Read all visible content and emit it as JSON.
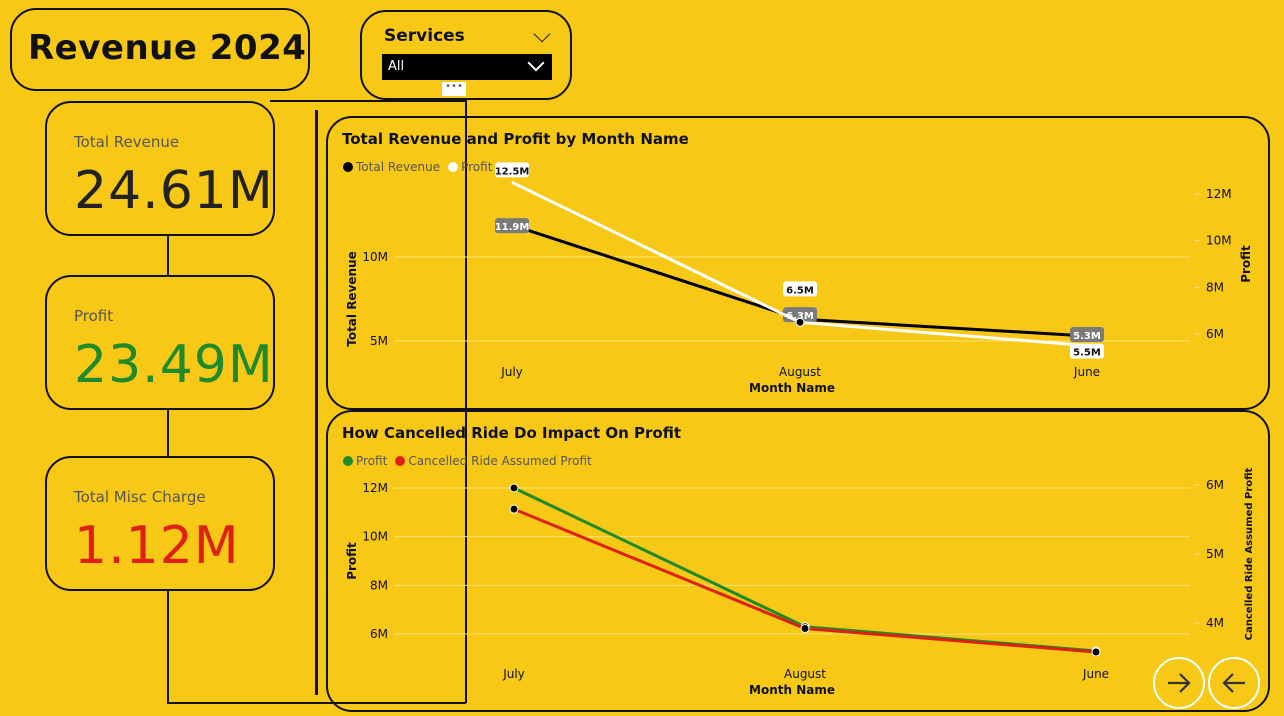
{
  "header": {
    "title": "Revenue 2024"
  },
  "slicer": {
    "label": "Services",
    "value": "All",
    "more": "•••"
  },
  "kpis": [
    {
      "label": "Total Revenue",
      "value": "24.61M",
      "color": "#222222"
    },
    {
      "label": "Profit",
      "value": "23.49M",
      "color": "#1e8a2b"
    },
    {
      "label": "Total Misc Charge",
      "value": "1.12M",
      "color": "#e0200f"
    }
  ],
  "colors": {
    "background": "#f7c815",
    "profit_green": "#1e8a2b",
    "cancel_red": "#e0200f"
  },
  "chart_data": [
    {
      "type": "line",
      "title": "Total Revenue and Profit by Month Name",
      "xlabel": "Month Name",
      "ylabel": "Total Revenue",
      "y2label": "Profit",
      "categories": [
        "July",
        "August",
        "June"
      ],
      "series": [
        {
          "name": "Total Revenue",
          "axis": "left",
          "color": "#000000",
          "values": [
            11.9,
            6.3,
            5.3
          ],
          "labels": [
            "11.9M",
            "6.3M",
            "5.3M"
          ]
        },
        {
          "name": "Profit",
          "axis": "right",
          "color": "#ffffff",
          "values": [
            12.5,
            6.5,
            5.5
          ],
          "labels": [
            "12.5M",
            "6.5M",
            "5.5M"
          ]
        }
      ],
      "y_ticks": [
        "5M",
        "10M"
      ],
      "y2_ticks": [
        "6M",
        "8M",
        "10M",
        "12M"
      ],
      "legend": "top-left",
      "grid": true
    },
    {
      "type": "line",
      "title": "How Cancelled Ride Do Impact On Profit",
      "xlabel": "Month Name",
      "ylabel": "Profit",
      "y2label": "Cancelled Ride Assumed Profit",
      "categories": [
        "July",
        "August",
        "June"
      ],
      "series": [
        {
          "name": "Profit",
          "axis": "left",
          "color": "#1e8a2b",
          "values": [
            12.0,
            6.3,
            5.3
          ]
        },
        {
          "name": "Cancelled Ride Assumed Profit",
          "axis": "right",
          "color": "#e0200f",
          "values": [
            5.65,
            3.92,
            3.58
          ]
        }
      ],
      "y_ticks": [
        "6M",
        "8M",
        "10M",
        "12M"
      ],
      "y2_ticks": [
        "4M",
        "5M",
        "6M"
      ],
      "legend": "top-left",
      "grid": true
    }
  ]
}
